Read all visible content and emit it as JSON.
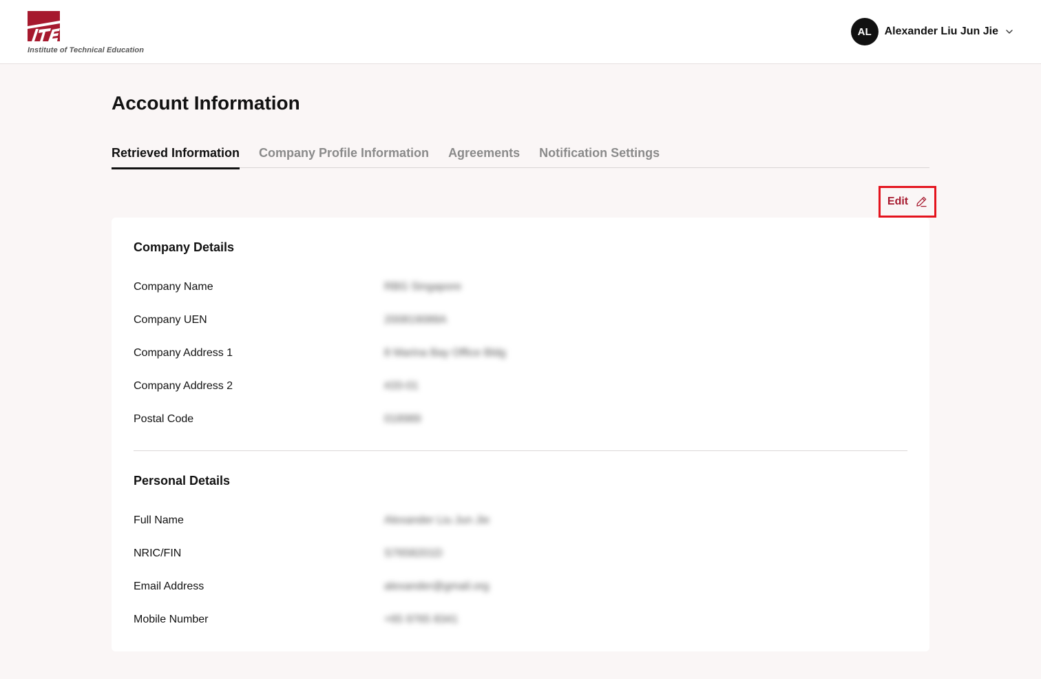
{
  "header": {
    "logo_caption": "Institute of Technical Education",
    "user": {
      "initials": "AL",
      "name": "Alexander Liu Jun Jie"
    }
  },
  "page": {
    "title": "Account Information",
    "tabs": [
      {
        "label": "Retrieved Information",
        "active": true
      },
      {
        "label": "Company Profile Information",
        "active": false
      },
      {
        "label": "Agreements",
        "active": false
      },
      {
        "label": "Notification Settings",
        "active": false
      }
    ],
    "edit_label": "Edit"
  },
  "company": {
    "title": "Company Details",
    "fields": [
      {
        "label": "Company Name",
        "value": "RBG Singapore"
      },
      {
        "label": "Company UEN",
        "value": "200819088A"
      },
      {
        "label": "Company Address 1",
        "value": "8 Marina Bay Office Bldg"
      },
      {
        "label": "Company Address 2",
        "value": "#20-01"
      },
      {
        "label": "Postal Code",
        "value": "018989"
      }
    ]
  },
  "personal": {
    "title": "Personal Details",
    "fields": [
      {
        "label": "Full Name",
        "value": "Alexander Liu Jun Jie"
      },
      {
        "label": "NRIC/FIN",
        "value": "S7658201D"
      },
      {
        "label": "Email Address",
        "value": "alexander@gmail.org"
      },
      {
        "label": "Mobile Number",
        "value": "+65 9765 8341"
      }
    ]
  },
  "colors": {
    "brand": "#a6192e",
    "highlight": "#e4131d",
    "background": "#faf6f6"
  }
}
